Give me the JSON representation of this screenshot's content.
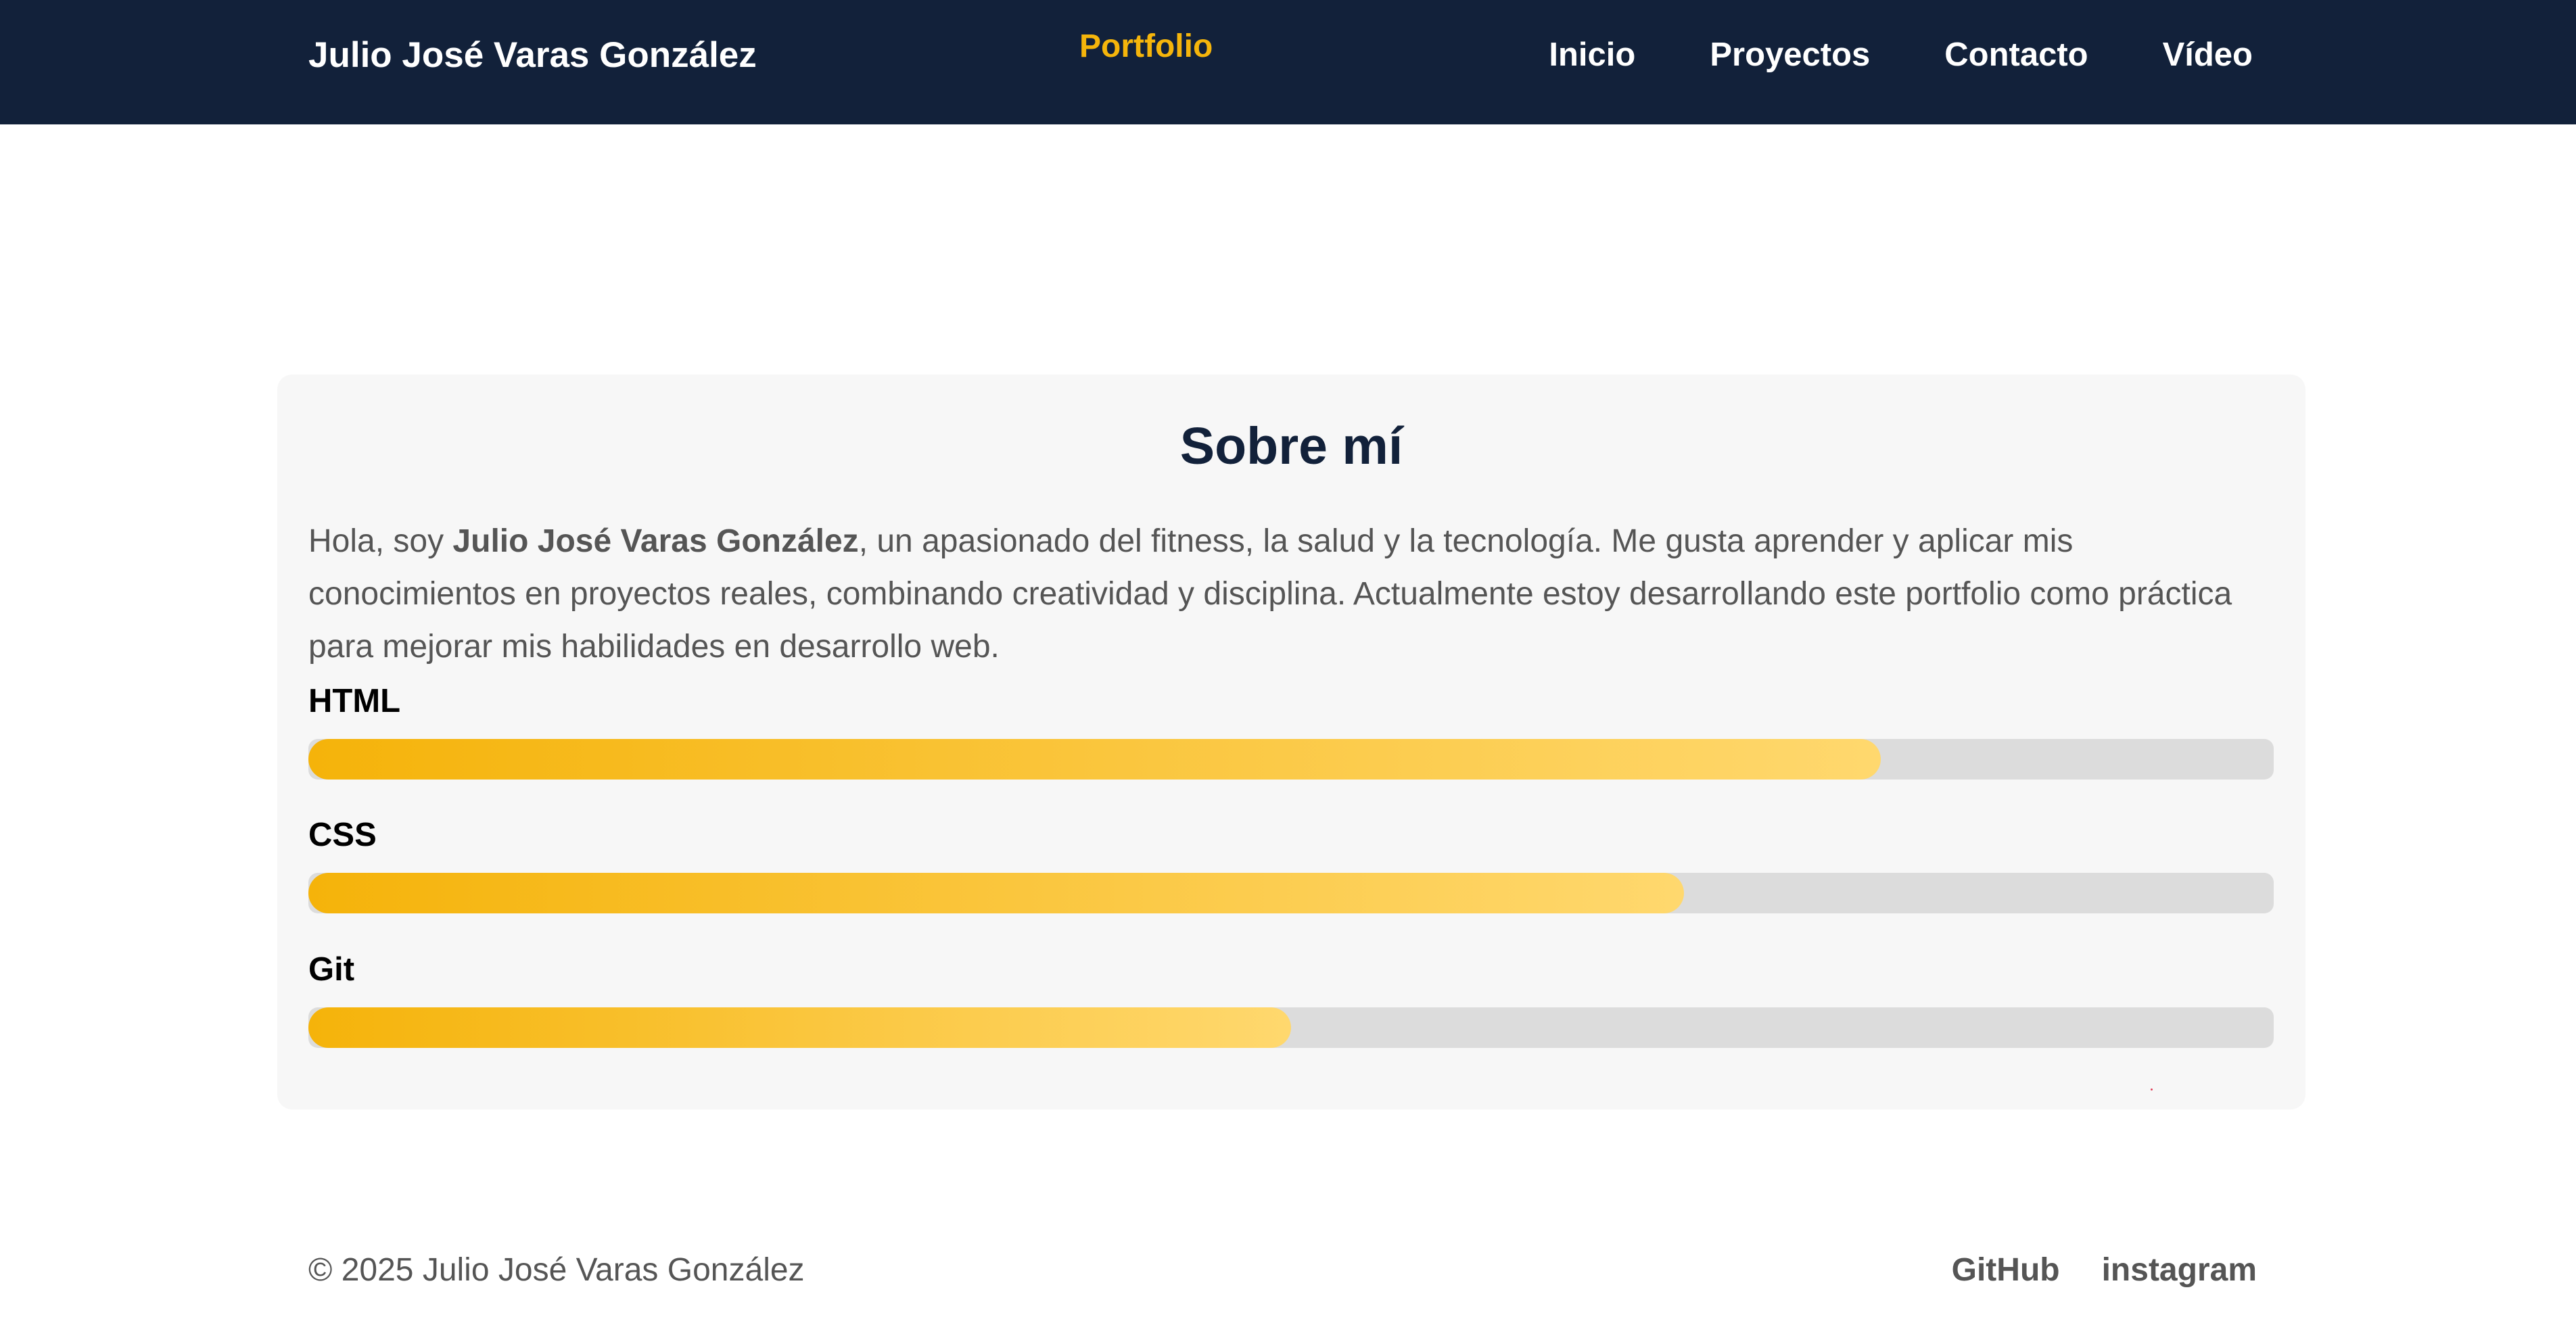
{
  "header": {
    "brand": "Julio José Varas González",
    "section_title": "Portfolio",
    "nav": {
      "inicio": "Inicio",
      "proyectos": "Proyectos",
      "contacto": "Contacto",
      "video": "Vídeo"
    }
  },
  "about": {
    "title": "Sobre mí",
    "intro_prefix": "Hola, soy ",
    "intro_name": "Julio José Varas González",
    "intro_suffix": ", un apasionado del fitness, la salud y la tecnología. Me gusta aprender y aplicar mis conocimientos en proyectos reales, combinando creatividad y disciplina. Actualmente estoy desarrollando este portfolio como práctica para mejorar mis habilidades en desarrollo web.",
    "skills": [
      {
        "label": "HTML",
        "percent": 80
      },
      {
        "label": "CSS",
        "percent": 70
      },
      {
        "label": "Git",
        "percent": 50
      }
    ]
  },
  "footer": {
    "copyright": "© 2025 Julio José Varas González",
    "links": {
      "github": "GitHub",
      "instagram": "instagram"
    }
  },
  "colors": {
    "header_bg": "#12213a",
    "accent": "#f5b50b",
    "card_bg": "#f7f7f7",
    "bar_track": "#dcdcdc",
    "bar_gradient_start": "#f5b30a",
    "bar_gradient_end": "#ffd86e",
    "text_muted": "#555555"
  }
}
